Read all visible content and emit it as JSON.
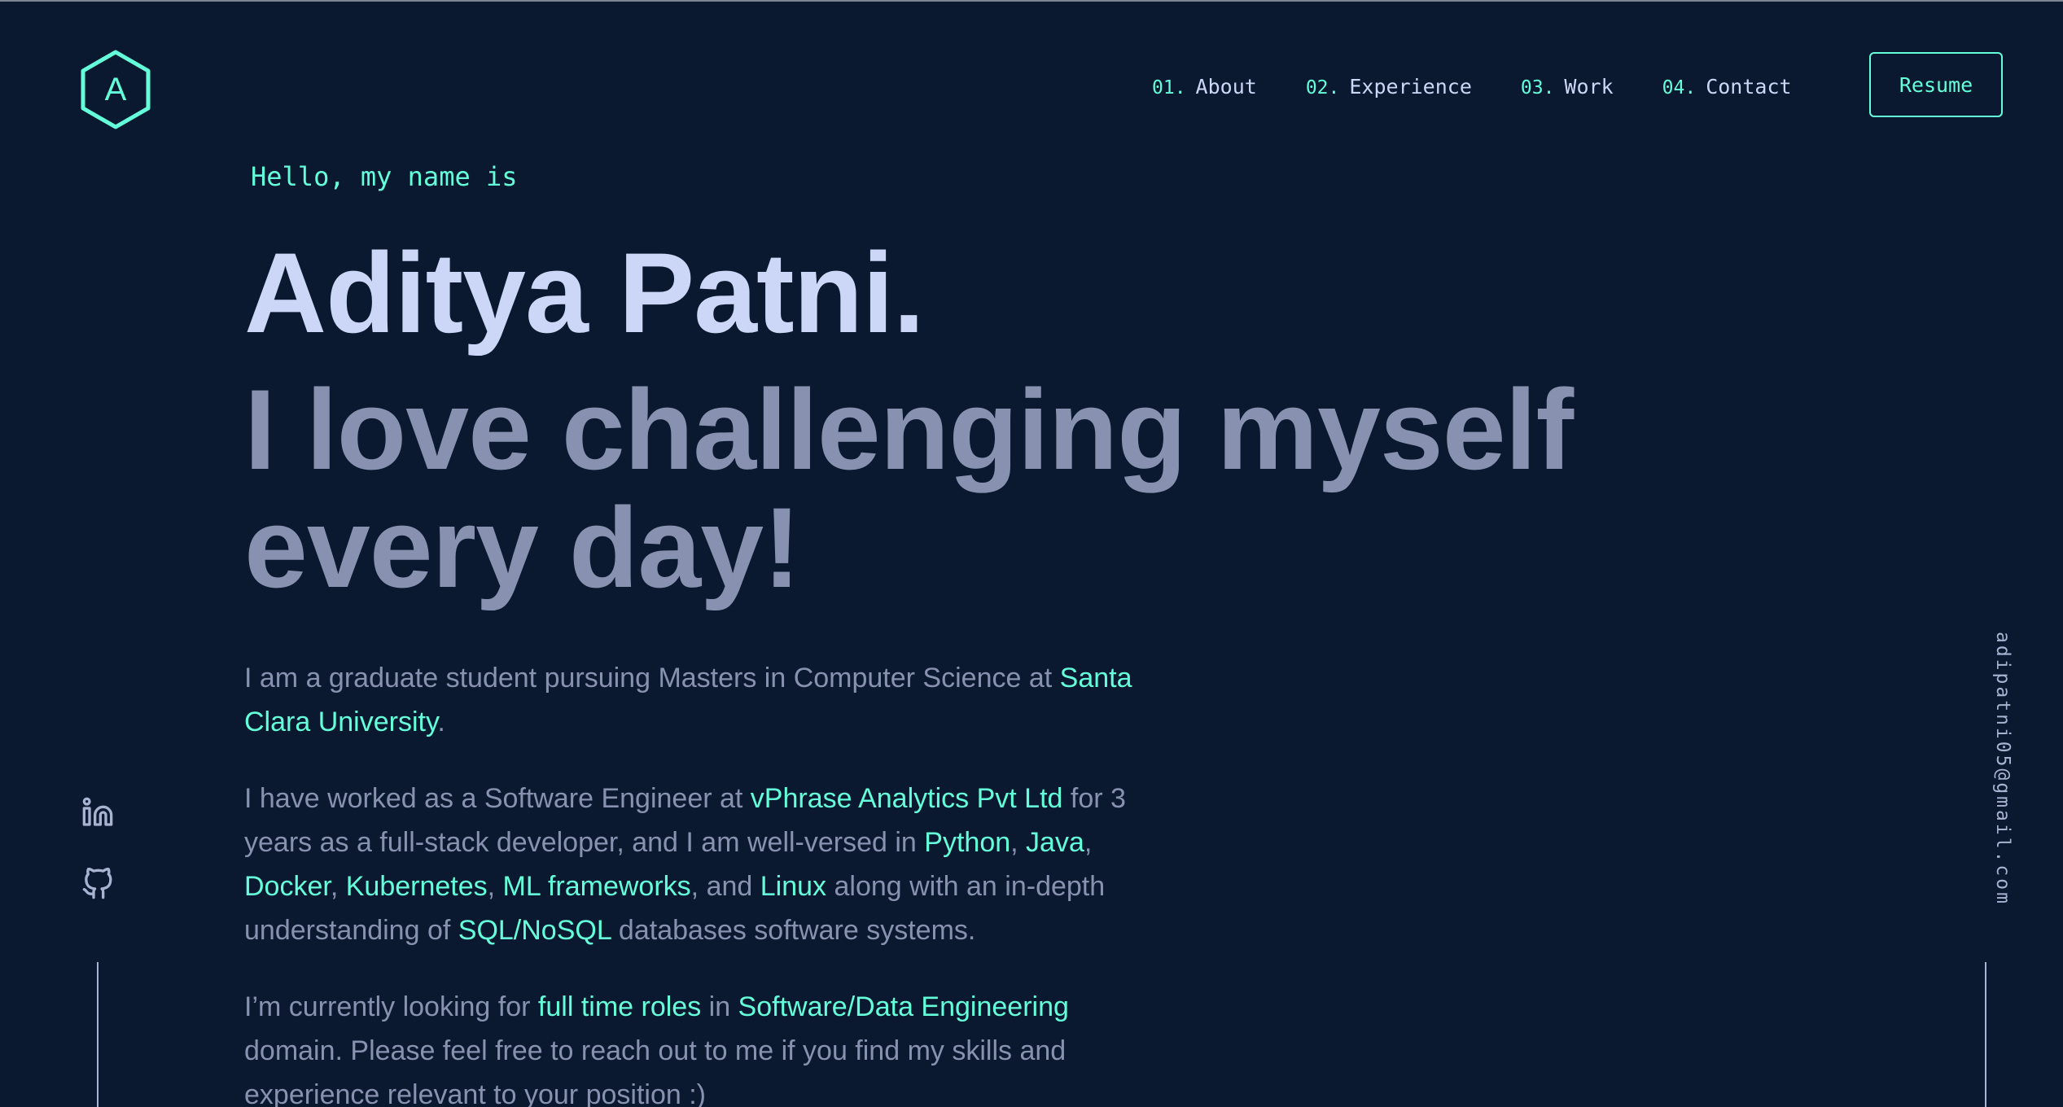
{
  "header": {
    "logo_letter": "A",
    "nav": [
      {
        "num": "01.",
        "label": "About"
      },
      {
        "num": "02.",
        "label": "Experience"
      },
      {
        "num": "03.",
        "label": "Work"
      },
      {
        "num": "04.",
        "label": "Contact"
      }
    ],
    "resume_label": "Resume"
  },
  "hero": {
    "greeting": "Hello, my name is",
    "name": "Aditya Patni.",
    "tagline": "I love challenging myself every day!"
  },
  "about": {
    "p1_a": "I am a graduate student pursuing Masters in Computer Science at ",
    "p1_link": "Santa Clara University",
    "p1_b": ".",
    "p2_a": "I have worked as a Software Engineer at ",
    "p2_company": "vPhrase Analytics Pvt Ltd",
    "p2_b": " for 3 years as a full-stack developer, and I am well-versed in ",
    "p2_python": "Python",
    "p2_sep1": ", ",
    "p2_java": "Java",
    "p2_sep2": ", ",
    "p2_docker": "Docker",
    "p2_sep3": ", ",
    "p2_k8s": "Kubernetes",
    "p2_sep4": ", ",
    "p2_ml": "ML frameworks",
    "p2_sep5": ", and ",
    "p2_linux": "Linux",
    "p2_c": " along with an in-depth understanding of ",
    "p2_sql": "SQL/NoSQL",
    "p2_d": " databases software systems.",
    "p3_a": "I’m currently looking for ",
    "p3_roles": "full time roles",
    "p3_b": " in ",
    "p3_domain": "Software/Data Engineering",
    "p3_c": " domain. Please feel free to reach out to me if you find my skills and experience relevant to your position :)"
  },
  "social": {
    "icons": [
      "linkedin-icon",
      "github-icon"
    ]
  },
  "email": "adipatni05@gmail.com",
  "colors": {
    "background": "#0a192f",
    "accent": "#64ffda",
    "heading": "#ccd6f6",
    "body": "#8892b0",
    "lines": "#a8b2d1"
  }
}
